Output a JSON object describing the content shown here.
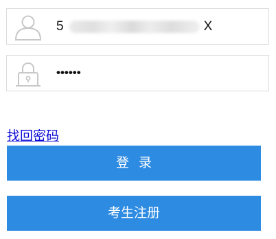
{
  "login_form": {
    "username": {
      "icon": "user-icon",
      "value_start": "5",
      "value_end": "X"
    },
    "password": {
      "icon": "lock-icon",
      "masked_value": "••••••"
    },
    "forgot_password_link": "找回密码",
    "login_button": "登录",
    "register_button": "考生注册"
  },
  "colors": {
    "button_background": "#2d8be2",
    "button_text": "#ffffff",
    "link": "#0b0bd6",
    "field_border": "#dcdcdc",
    "icon_stroke": "#c8c8c8"
  }
}
